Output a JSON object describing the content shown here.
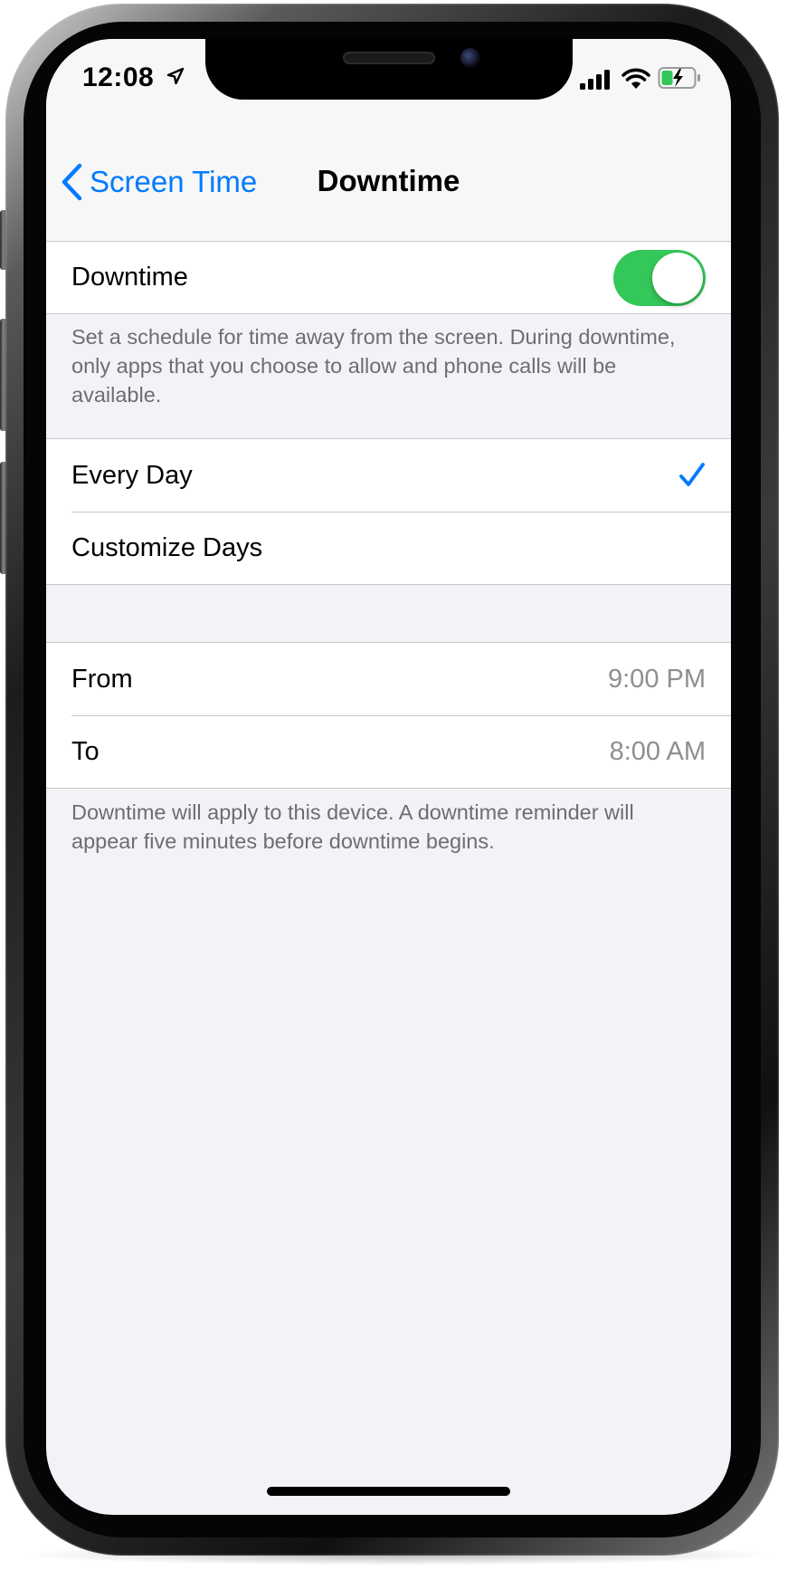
{
  "status_bar": {
    "time": "12:08",
    "location_icon": "location-arrow-icon",
    "signal_icon": "cellular-signal-icon",
    "wifi_icon": "wifi-icon",
    "battery_icon": "battery-charging-icon"
  },
  "nav": {
    "back_label": "Screen Time",
    "back_icon": "chevron-left-icon",
    "title": "Downtime"
  },
  "downtime_group": {
    "label": "Downtime",
    "toggle_on": true
  },
  "description": "Set a schedule for time away from the screen. During downtime, only apps that you choose to allow and phone calls will be available.",
  "schedule_group": {
    "items": [
      {
        "label": "Every Day",
        "selected": true
      },
      {
        "label": "Customize Days",
        "selected": false
      }
    ]
  },
  "time_group": {
    "items": [
      {
        "label": "From",
        "value": "9:00 PM"
      },
      {
        "label": "To",
        "value": "8:00 AM"
      }
    ]
  },
  "footer": "Downtime will apply to this device. A downtime reminder will appear five minutes before downtime begins.",
  "colors": {
    "accent": "#007aff",
    "toggle_on": "#34c759",
    "background": "#f2f2f7",
    "secondary_text": "#8e8e93",
    "separator": "#c8c7cc"
  }
}
